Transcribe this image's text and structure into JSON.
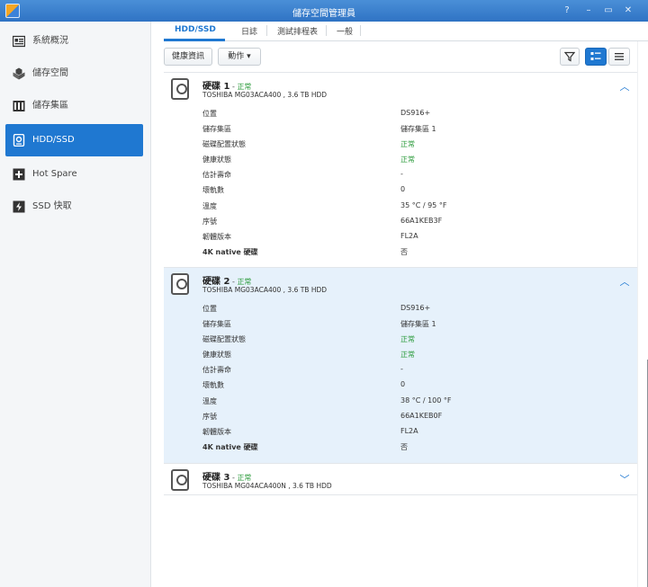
{
  "window": {
    "title": "儲存空間管理員",
    "controls": [
      "?",
      "–",
      "▭",
      "✕"
    ]
  },
  "sidebar": {
    "items": [
      {
        "label": "系統概況",
        "icon": "overview-icon",
        "active": false
      },
      {
        "label": "儲存空間",
        "icon": "volume-icon",
        "active": false
      },
      {
        "label": "儲存集區",
        "icon": "storage-pool-icon",
        "active": false
      },
      {
        "label": "HDD/SSD",
        "icon": "hdd-icon",
        "active": true
      },
      {
        "label": "Hot Spare",
        "icon": "hot-spare-icon",
        "active": false
      },
      {
        "label": "SSD 快取",
        "icon": "ssd-cache-icon",
        "active": false
      }
    ]
  },
  "tabs": [
    "HDD/SSD",
    "日誌",
    "測試排程表",
    "一般"
  ],
  "toolbar": {
    "health_info_label": "健康資訊",
    "action_label": "動作",
    "action_caret": "▾"
  },
  "disks": [
    {
      "title": "硬碟 1",
      "dash": " - ",
      "status": "正常",
      "model": "TOSHIBA MG03ACA400 , 3.6 TB HDD",
      "expanded": true,
      "details": [
        {
          "label": "位置",
          "value": "DS916+"
        },
        {
          "label": "儲存集區",
          "value": "儲存集區 1"
        },
        {
          "label": "磁碟配置狀態",
          "value": "正常",
          "ok": true
        },
        {
          "label": "健康狀態",
          "value": "正常",
          "ok": true
        },
        {
          "label": "估計壽命",
          "value": "-"
        },
        {
          "label": "壞軌數",
          "value": "0"
        },
        {
          "label": "溫度",
          "value": "35 °C / 95 °F"
        },
        {
          "label": "序號",
          "value": "66A1KEB3F"
        },
        {
          "label": "韌體版本",
          "value": "FL2A"
        },
        {
          "label": "4K native 硬碟",
          "value": "否",
          "bold": true
        }
      ]
    },
    {
      "title": "硬碟 2",
      "dash": " - ",
      "status": "正常",
      "model": "TOSHIBA MG03ACA400 , 3.6 TB HDD",
      "expanded": true,
      "details": [
        {
          "label": "位置",
          "value": "DS916+"
        },
        {
          "label": "儲存集區",
          "value": "儲存集區 1"
        },
        {
          "label": "磁碟配置狀態",
          "value": "正常",
          "ok": true
        },
        {
          "label": "健康狀態",
          "value": "正常",
          "ok": true
        },
        {
          "label": "估計壽命",
          "value": "-"
        },
        {
          "label": "壞軌數",
          "value": "0"
        },
        {
          "label": "溫度",
          "value": "38 °C / 100 °F"
        },
        {
          "label": "序號",
          "value": "66A1KEB0F"
        },
        {
          "label": "韌體版本",
          "value": "FL2A"
        },
        {
          "label": "4K native 硬碟",
          "value": "否",
          "bold": true
        }
      ]
    },
    {
      "title": "硬碟 3",
      "dash": " - ",
      "status": "正常",
      "model": "TOSHIBA MG04ACA400N , 3.6 TB HDD",
      "expanded": false,
      "details": []
    }
  ],
  "colors": {
    "accent": "#1f78d1",
    "ok": "#2a9a3a",
    "selected_row": "#e6f1fb"
  }
}
